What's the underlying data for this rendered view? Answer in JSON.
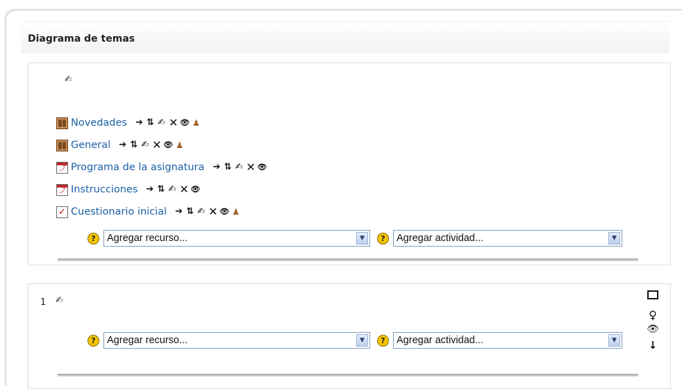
{
  "header": {
    "title": "Diagrama de temas"
  },
  "section0": {
    "edit_icon": "edit-summary-icon",
    "resources": [
      {
        "name": "Novedades",
        "icon": "forum-icon",
        "has_group_icon": true
      },
      {
        "name": "General",
        "icon": "forum-icon",
        "has_group_icon": true
      },
      {
        "name": "Programa de la asignatura",
        "icon": "pdf-icon",
        "has_group_icon": false
      },
      {
        "name": "Instrucciones",
        "icon": "pdf-icon",
        "has_group_icon": false
      },
      {
        "name": "Cuestionario inicial",
        "icon": "quiz-icon",
        "has_group_icon": true
      }
    ],
    "add_resource": "Agregar recurso...",
    "add_activity": "Agregar actividad..."
  },
  "section1": {
    "number": "1",
    "add_resource": "Agregar recurso...",
    "add_activity": "Agregar actividad..."
  },
  "glyphs": {
    "move_right": "➔",
    "move": "⇅",
    "edit": "✍",
    "delete": "✕",
    "hide": "👁",
    "group": "♟",
    "help": "?",
    "dropdown": "▼",
    "highlight": "♀",
    "show": "👁",
    "down": "↓"
  },
  "colors": {
    "link": "#1a5fa6",
    "help_icon": "#f5c400"
  }
}
